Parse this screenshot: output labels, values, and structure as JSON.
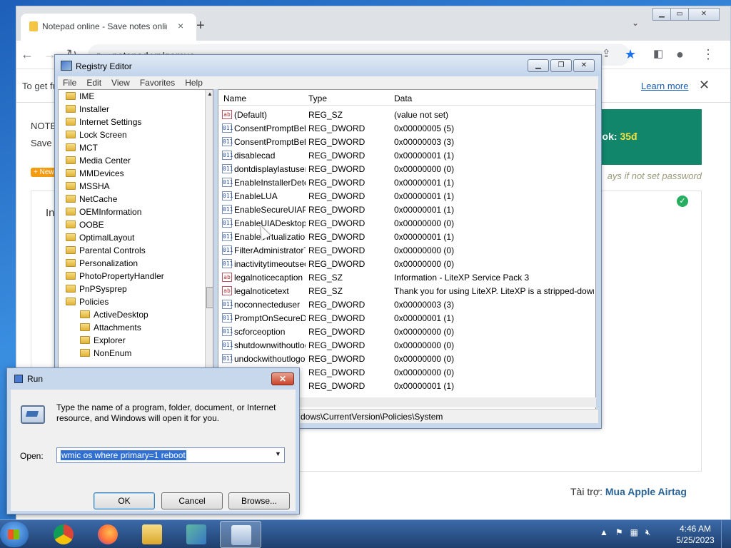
{
  "desktop": {
    "background": "#2a6fc9"
  },
  "chrome": {
    "tab_title": "Notepad online - Save notes online",
    "tab_close": "×",
    "new_tab": "+",
    "tab_menu": "⌄",
    "url": "notepad.vn/gemuc",
    "infobar_message": "To get fu",
    "learn_more": "Learn more",
    "infobar_close": "✕",
    "page": {
      "note_title": "NOTE",
      "note_sub": "Save",
      "new_badge": "+ New",
      "promo_text": "ook:",
      "promo_price": "35đ",
      "pw_note": "ays if not set password",
      "editor_text": "In",
      "sponsor_label": "Tài trợ:",
      "sponsor_link": "Mua Apple Airtag"
    }
  },
  "regedit": {
    "title": "Registry Editor",
    "menu": [
      "File",
      "Edit",
      "View",
      "Favorites",
      "Help"
    ],
    "tree": [
      {
        "label": "IME",
        "indent": 0
      },
      {
        "label": "Installer",
        "indent": 0
      },
      {
        "label": "Internet Settings",
        "indent": 0
      },
      {
        "label": "Lock Screen",
        "indent": 0
      },
      {
        "label": "MCT",
        "indent": 0
      },
      {
        "label": "Media Center",
        "indent": 0
      },
      {
        "label": "MMDevices",
        "indent": 0
      },
      {
        "label": "MSSHA",
        "indent": 0
      },
      {
        "label": "NetCache",
        "indent": 0
      },
      {
        "label": "OEMInformation",
        "indent": 0
      },
      {
        "label": "OOBE",
        "indent": 0
      },
      {
        "label": "OptimalLayout",
        "indent": 0
      },
      {
        "label": "Parental Controls",
        "indent": 0
      },
      {
        "label": "Personalization",
        "indent": 0
      },
      {
        "label": "PhotoPropertyHandler",
        "indent": 0
      },
      {
        "label": "PnPSysprep",
        "indent": 0
      },
      {
        "label": "Policies",
        "indent": 0
      },
      {
        "label": "ActiveDesktop",
        "indent": 1
      },
      {
        "label": "Attachments",
        "indent": 1
      },
      {
        "label": "Explorer",
        "indent": 1
      },
      {
        "label": "NonEnum",
        "indent": 1
      }
    ],
    "columns": {
      "name": "Name",
      "type": "Type",
      "data": "Data"
    },
    "values": [
      {
        "name": "(Default)",
        "type": "REG_SZ",
        "data": "(value not set)",
        "kind": "sz"
      },
      {
        "name": "ConsentPromptBehaviorAdmin",
        "type": "REG_DWORD",
        "data": "0x00000005 (5)",
        "kind": "dw"
      },
      {
        "name": "ConsentPromptBehaviorUser",
        "type": "REG_DWORD",
        "data": "0x00000003 (3)",
        "kind": "dw"
      },
      {
        "name": "disablecad",
        "type": "REG_DWORD",
        "data": "0x00000001 (1)",
        "kind": "dw"
      },
      {
        "name": "dontdisplaylastusername",
        "type": "REG_DWORD",
        "data": "0x00000000 (0)",
        "kind": "dw"
      },
      {
        "name": "EnableInstallerDetection",
        "type": "REG_DWORD",
        "data": "0x00000001 (1)",
        "kind": "dw"
      },
      {
        "name": "EnableLUA",
        "type": "REG_DWORD",
        "data": "0x00000001 (1)",
        "kind": "dw"
      },
      {
        "name": "EnableSecureUIAPaths",
        "type": "REG_DWORD",
        "data": "0x00000001 (1)",
        "kind": "dw"
      },
      {
        "name": "EnableUIADesktopToggle",
        "type": "REG_DWORD",
        "data": "0x00000000 (0)",
        "kind": "dw"
      },
      {
        "name": "EnableVirtualization",
        "type": "REG_DWORD",
        "data": "0x00000001 (1)",
        "kind": "dw"
      },
      {
        "name": "FilterAdministratorToken",
        "type": "REG_DWORD",
        "data": "0x00000000 (0)",
        "kind": "dw"
      },
      {
        "name": "inactivitytimeoutsecs",
        "type": "REG_DWORD",
        "data": "0x00000000 (0)",
        "kind": "dw"
      },
      {
        "name": "legalnoticecaption",
        "type": "REG_SZ",
        "data": "Information - LiteXP Service Pack 3",
        "kind": "sz"
      },
      {
        "name": "legalnoticetext",
        "type": "REG_SZ",
        "data": "Thank you for using LiteXP. LiteXP is a stripped-down",
        "kind": "sz"
      },
      {
        "name": "noconnecteduser",
        "type": "REG_DWORD",
        "data": "0x00000003 (3)",
        "kind": "dw"
      },
      {
        "name": "PromptOnSecureDesktop",
        "type": "REG_DWORD",
        "data": "0x00000001 (1)",
        "kind": "dw"
      },
      {
        "name": "scforceoption",
        "type": "REG_DWORD",
        "data": "0x00000000 (0)",
        "kind": "dw"
      },
      {
        "name": "shutdownwithoutlogon",
        "type": "REG_DWORD",
        "data": "0x00000000 (0)",
        "kind": "dw"
      },
      {
        "name": "undockwithoutlogon",
        "type": "REG_DWORD",
        "data": "0x00000000 (0)",
        "kind": "dw"
      },
      {
        "name": "",
        "type": "REG_DWORD",
        "data": "0x00000000 (0)",
        "kind": "dw"
      },
      {
        "name": "",
        "type": "REG_DWORD",
        "data": "0x00000001 (1)",
        "kind": "dw"
      }
    ],
    "status_path": "dows\\CurrentVersion\\Policies\\System"
  },
  "run": {
    "title": "Run",
    "close": "✕",
    "description": "Type the name of a program, folder, document, or Internet resource, and Windows will open it for you.",
    "open_label": "Open:",
    "command": "wmic os where primary=1 reboot",
    "ok": "OK",
    "cancel": "Cancel",
    "browse": "Browse..."
  },
  "taskbar": {
    "time": "4:46 AM",
    "date": "5/25/2023",
    "tray_arrow": "▲"
  },
  "colors": {
    "accent": "#12866a",
    "price": "#f5e342",
    "link": "#1a5fb4"
  }
}
